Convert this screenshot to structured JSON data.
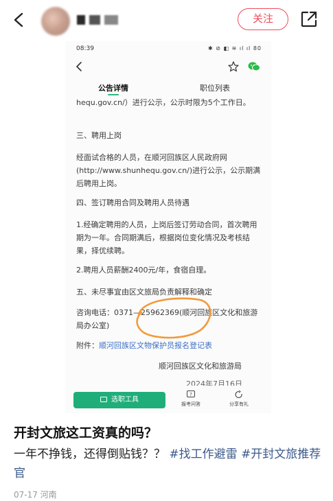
{
  "header": {
    "follow_label": "关注"
  },
  "screenshot": {
    "status_time": "08:39",
    "status_icons": "✱ ⊘ ◧ ≋ ıl ıl 80",
    "tabs": {
      "active": "公告详情",
      "inactive": "职位列表"
    },
    "article": {
      "p1": "hequ.gov.cn/）进行公示，公示时限为5个工作日。",
      "p2": "三、聘用上岗",
      "p3": "经面试合格的人员，在顺河回族区人民政府网(http://www.shunhequ.gov.cn/)进行公示，公示期满后聘用上岗。",
      "p4": "四、签订聘用合同及聘用人员待遇",
      "p5": "1.经确定聘用的人员，上岗后签订劳动合同，首次聘用期为一年。合同期满后，根据岗位变化情况及考核结果，择优续聘。",
      "p6": "2.聘用人员薪酬2400元/年，食宿自理。",
      "p7": "五、未尽事宜由区文旅局负责解释和确定",
      "p8": "咨询电话：0371—25962369(顺河回族区文化和旅游局办公室)",
      "attachment_prefix": "附件：",
      "attachment_link": "顺河回族区文物保护员报名登记表",
      "signature": "顺河回族区文化和旅游局",
      "date_partial": "2024年7月16日"
    },
    "bottom_bar": {
      "tool_label": "选职工具",
      "qa_label": "报考问答",
      "share_label": "分享有礼"
    }
  },
  "post": {
    "title": "开封文旅这工资真的吗？",
    "body_text": "一年不挣钱，还得倒贴钱？？",
    "tag1": "#找工作避雷",
    "tag2": "#开封文旅推荐官",
    "meta": "07-17 河南"
  },
  "colors": {
    "accent_red": "#f04a5a",
    "brand_green": "#1fae7a",
    "annotation_orange": "#f29a3a",
    "link_blue": "#3c6fc5"
  }
}
